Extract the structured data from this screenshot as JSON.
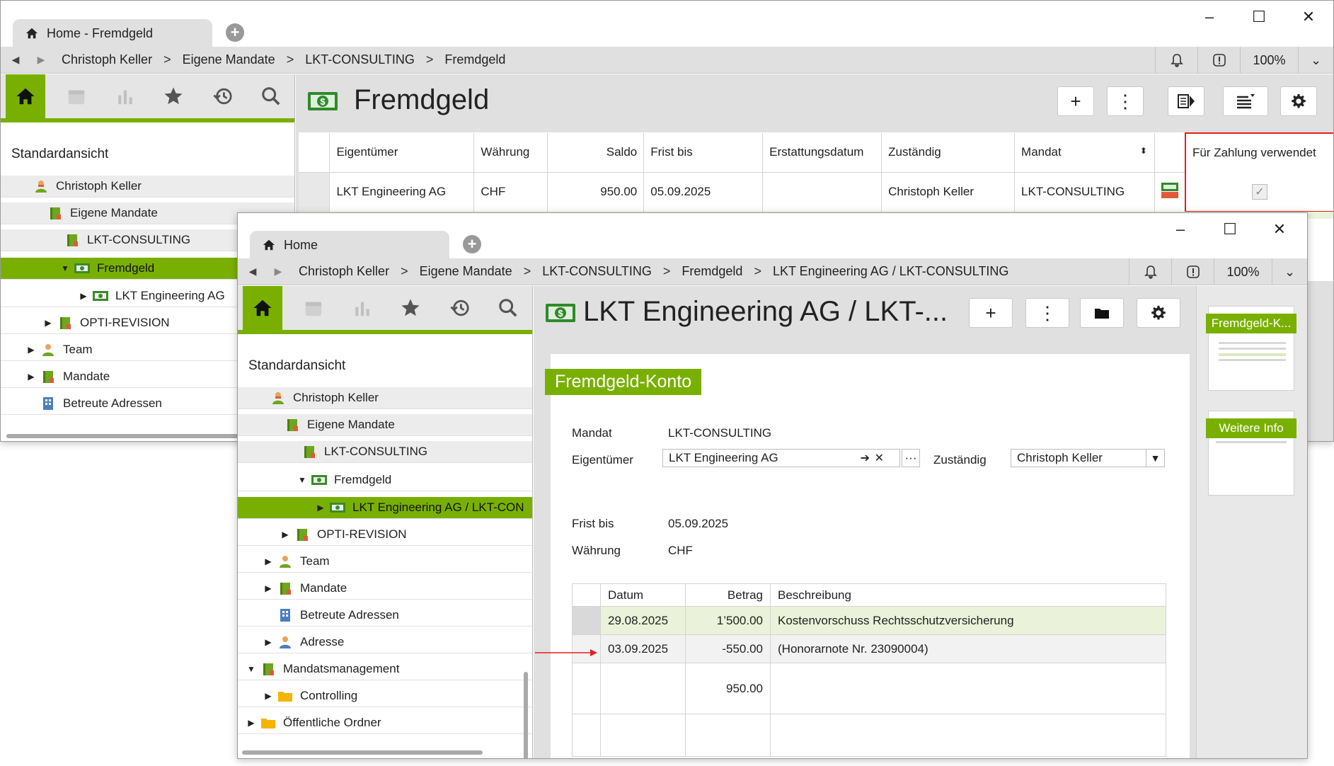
{
  "back_window": {
    "tab_title": "Home - Fremdgeld",
    "breadcrumb": [
      "Christoph Keller",
      "Eigene Mandate",
      "LKT-CONSULTING",
      "Fremdgeld"
    ],
    "zoom": "100%",
    "page_title": "Fremdgeld",
    "view_title": "Standardansicht",
    "tree": [
      {
        "label": "Christoph Keller"
      },
      {
        "label": "Eigene Mandate"
      },
      {
        "label": "LKT-CONSULTING"
      },
      {
        "label": "Fremdgeld"
      },
      {
        "label": "LKT Engineering AG"
      },
      {
        "label": "OPTI-REVISION"
      },
      {
        "label": "Team"
      },
      {
        "label": "Mandate"
      },
      {
        "label": "Betreute Adressen"
      }
    ],
    "table": {
      "headers": [
        "Eigentümer",
        "Währung",
        "Saldo",
        "Frist bis",
        "Erstattungsdatum",
        "Zuständig",
        "Mandat",
        "",
        "Für Zahlung verwendet"
      ],
      "rows": [
        {
          "eigentuemer": "LKT Engineering AG",
          "waehrung": "CHF",
          "saldo": "950.00",
          "frist": "05.09.2025",
          "erstattung": "",
          "zustaendig": "Christoph Keller",
          "mandat": "LKT-CONSULTING"
        }
      ]
    }
  },
  "front_window": {
    "tab_title": "Home",
    "breadcrumb": [
      "Christoph Keller",
      "Eigene Mandate",
      "LKT-CONSULTING",
      "Fremdgeld",
      "LKT Engineering AG / LKT-CONSULTING"
    ],
    "zoom": "100%",
    "page_title": "LKT Engineering AG / LKT-...",
    "view_title": "Standardansicht",
    "tree": [
      {
        "label": "Christoph Keller"
      },
      {
        "label": "Eigene Mandate"
      },
      {
        "label": "LKT-CONSULTING"
      },
      {
        "label": "Fremdgeld"
      },
      {
        "label": "LKT Engineering AG / LKT-CON"
      },
      {
        "label": "OPTI-REVISION"
      },
      {
        "label": "Team"
      },
      {
        "label": "Mandate"
      },
      {
        "label": "Betreute Adressen"
      },
      {
        "label": "Adresse"
      },
      {
        "label": "Mandatsmanagement"
      },
      {
        "label": "Controlling"
      },
      {
        "label": "Öffentliche Ordner"
      }
    ],
    "section_title": "Fremdgeld-Konto",
    "form": {
      "mandat_label": "Mandat",
      "mandat_value": "LKT-CONSULTING",
      "eigentuemer_label": "Eigentümer",
      "eigentuemer_value": "LKT Engineering AG",
      "zustaendig_label": "Zuständig",
      "zustaendig_value": "Christoph Keller",
      "frist_label": "Frist bis",
      "frist_value": "05.09.2025",
      "waehrung_label": "Währung",
      "waehrung_value": "CHF"
    },
    "postings": {
      "headers": [
        "Datum",
        "Betrag",
        "Beschreibung"
      ],
      "rows": [
        {
          "datum": "29.08.2025",
          "betrag": "1’500.00",
          "beschreibung": "Kostenvorschuss Rechtsschutzversicherung"
        },
        {
          "datum": "03.09.2025",
          "betrag": "-550.00",
          "beschreibung": "(Honorarnote Nr. 23090004)"
        }
      ],
      "total": "950.00"
    },
    "thumbnails": [
      "Fremdgeld-K...",
      "Weitere Info"
    ]
  },
  "colors": {
    "accent": "#79b000",
    "highlight_border": "#e02020",
    "arrow": "#e02020"
  }
}
